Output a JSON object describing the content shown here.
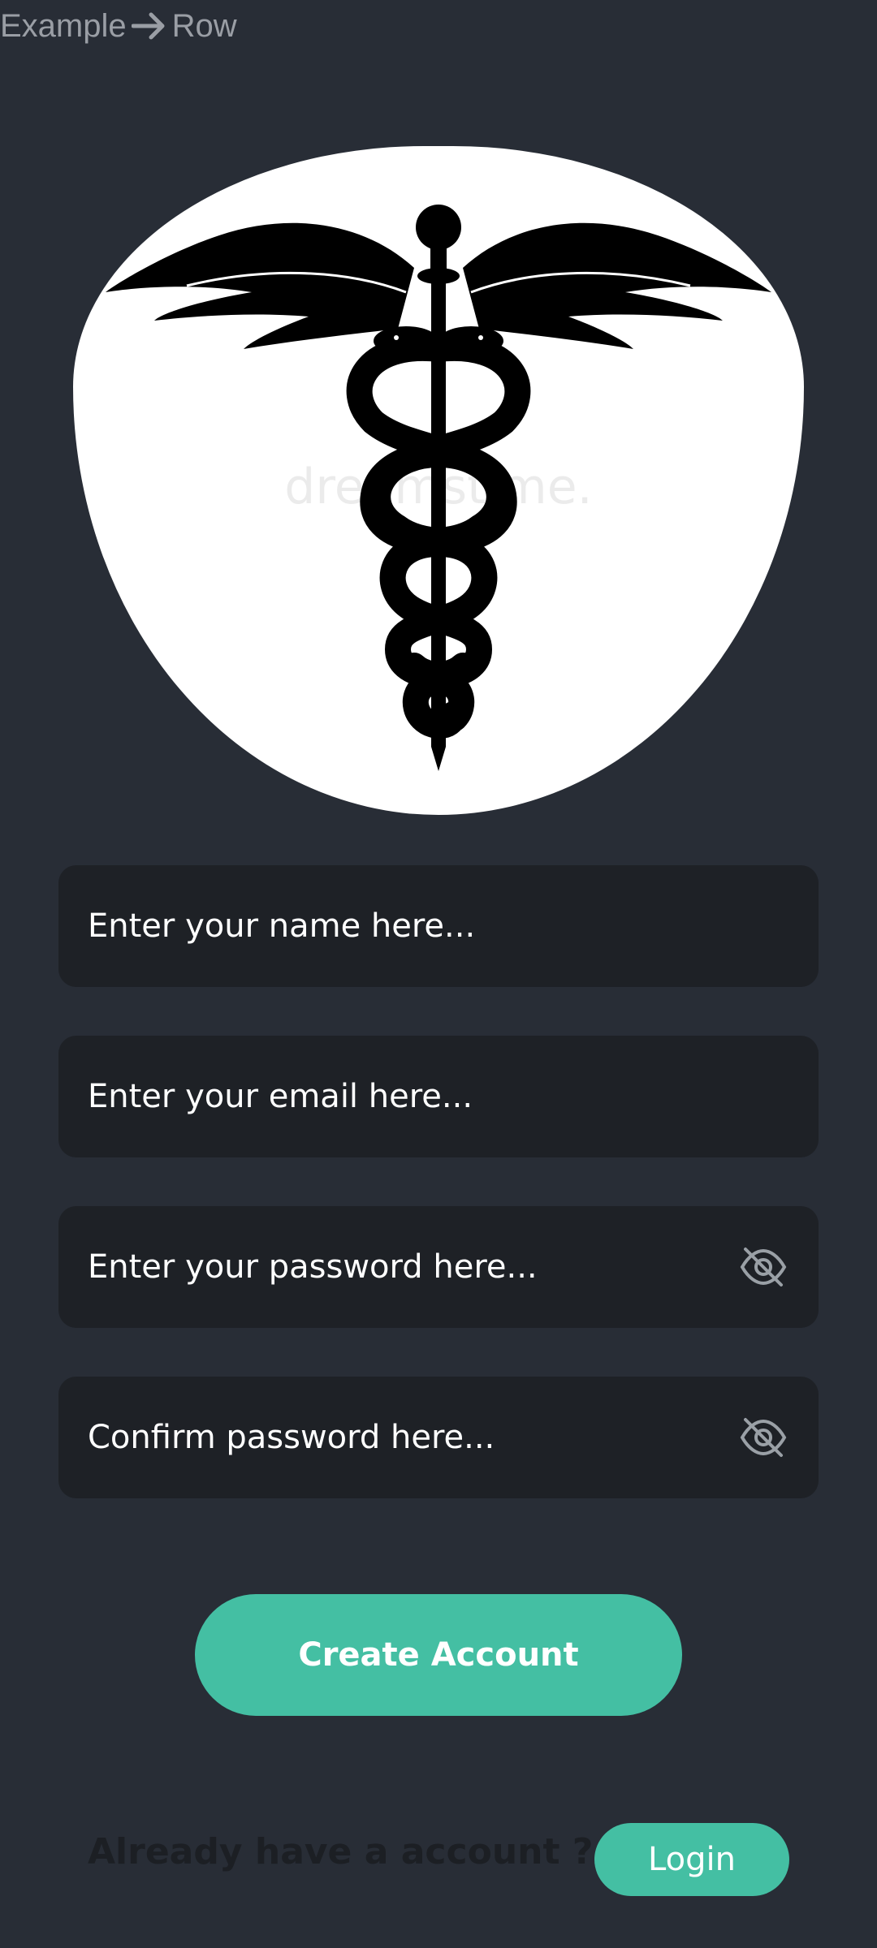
{
  "topbar": {
    "left_text": "Example",
    "right_text": "Row",
    "arrow_icon": "arrow-right-icon"
  },
  "logo": {
    "icon": "caduceus-icon",
    "watermark": "dreamstime."
  },
  "form": {
    "name_placeholder": "Enter your name here...",
    "email_placeholder": "Enter your email here...",
    "password_placeholder": "Enter your password here...",
    "confirm_placeholder": "Confirm password here...",
    "visibility_icon": "eye-off-icon"
  },
  "actions": {
    "create_label": "Create Account",
    "already_text": "Already have a account ?",
    "login_label": "Login"
  },
  "colors": {
    "background": "#282d36",
    "field": "#1e2126",
    "accent": "#44bfa3"
  }
}
